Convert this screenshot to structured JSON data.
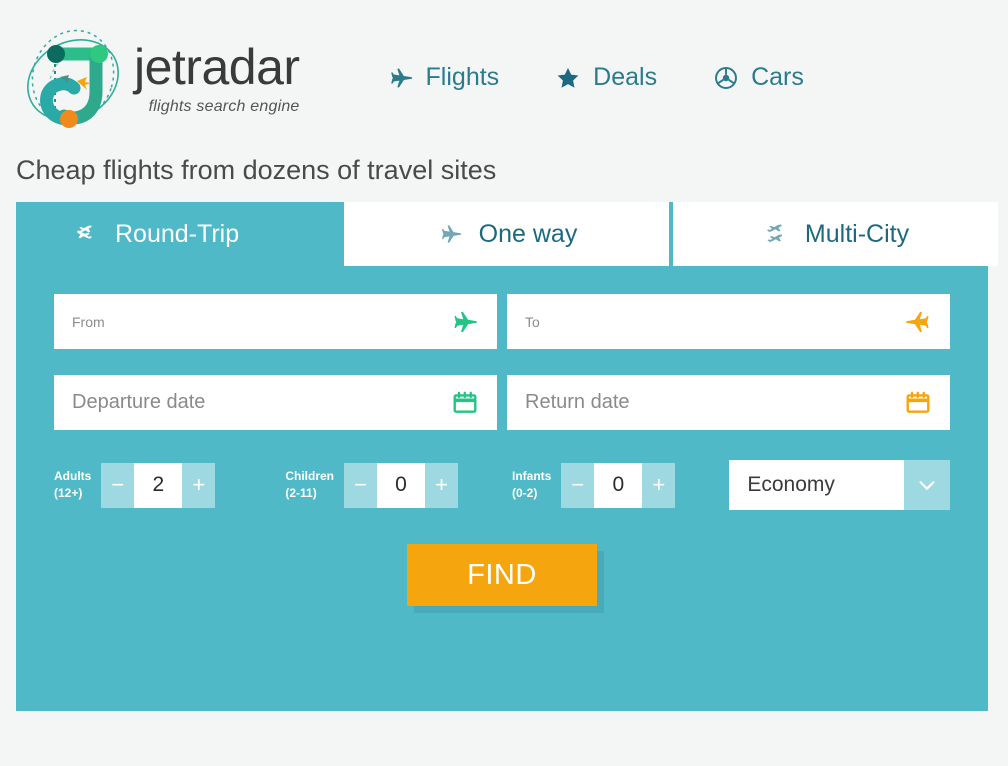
{
  "brand": {
    "name": "jetradar",
    "tagline": "flights search engine",
    "logo_icon": "jetradar-logo-icon"
  },
  "nav": {
    "items": [
      {
        "label": "Flights",
        "icon": "airplane-icon"
      },
      {
        "label": "Deals",
        "icon": "star-icon"
      },
      {
        "label": "Cars",
        "icon": "steering-wheel-icon"
      }
    ]
  },
  "heading": "Cheap flights from dozens of travel sites",
  "tabs": [
    {
      "label": "Round-Trip",
      "icon": "two-planes-roundtrip-icon",
      "active": true
    },
    {
      "label": "One way",
      "icon": "plane-oneway-icon",
      "active": false
    },
    {
      "label": "Multi-City",
      "icon": "two-planes-multicity-icon",
      "active": false
    }
  ],
  "form": {
    "origin": {
      "placeholder": "From",
      "value": "",
      "icon": "plane-takeoff-icon"
    },
    "destination": {
      "placeholder": "To",
      "value": "",
      "icon": "plane-landing-icon"
    },
    "departure": {
      "placeholder": "Departure date",
      "value": "",
      "icon": "calendar-icon"
    },
    "return": {
      "placeholder": "Return date",
      "value": "",
      "icon": "calendar-icon"
    },
    "passengers": [
      {
        "label_line1": "Adults",
        "label_line2": "(12+)",
        "value": "2",
        "minus": "−",
        "plus": "+"
      },
      {
        "label_line1": "Children",
        "label_line2": "(2-11)",
        "value": "0",
        "minus": "−",
        "plus": "+"
      },
      {
        "label_line1": "Infants",
        "label_line2": "(0-2)",
        "value": "0",
        "minus": "−",
        "plus": "+"
      }
    ],
    "cabin": {
      "value": "Economy",
      "arrow_icon": "chevron-down-icon"
    },
    "submit_label": "FIND"
  },
  "colors": {
    "panel_teal": "#4fb9c8",
    "light_teal": "#9ed9e2",
    "nav_teal": "#2b7b8c",
    "tab_text_teal": "#1d6a80",
    "orange": "#f5a60f",
    "green": "#25c485",
    "page_bg": "#f4f6f6"
  }
}
